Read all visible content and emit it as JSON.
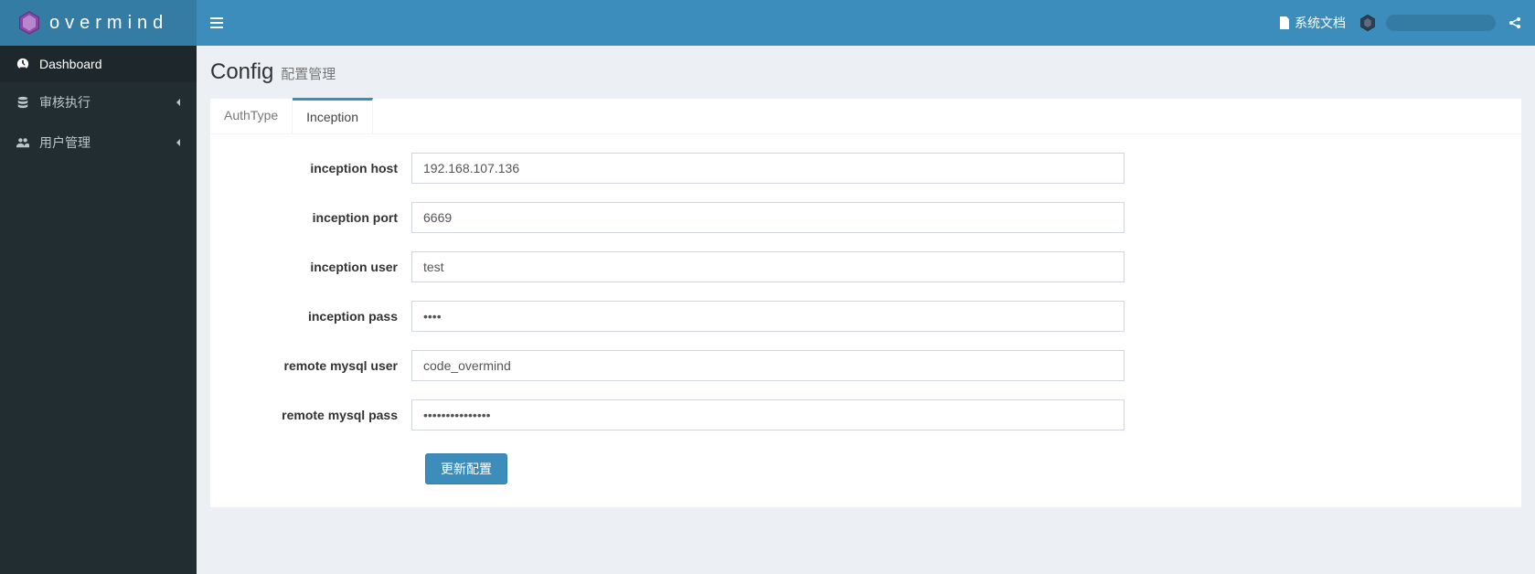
{
  "brand": "overmind",
  "sidebar": {
    "items": [
      {
        "label": "Dashboard",
        "icon": "dashboard-icon",
        "active": true,
        "hasChildren": false
      },
      {
        "label": "审核执行",
        "icon": "database-icon",
        "active": false,
        "hasChildren": true
      },
      {
        "label": "用户管理",
        "icon": "users-icon",
        "active": false,
        "hasChildren": true
      }
    ]
  },
  "topbar": {
    "docs_label": "系统文档",
    "username": ""
  },
  "page": {
    "title": "Config",
    "subtitle": "配置管理"
  },
  "tabs": [
    {
      "label": "AuthType",
      "active": false
    },
    {
      "label": "Inception",
      "active": true
    }
  ],
  "form": {
    "fields": [
      {
        "label": "inception host",
        "value": "192.168.107.136",
        "type": "text"
      },
      {
        "label": "inception port",
        "value": "6669",
        "type": "text"
      },
      {
        "label": "inception user",
        "value": "test",
        "type": "text"
      },
      {
        "label": "inception pass",
        "value": "••••",
        "type": "password"
      },
      {
        "label": "remote mysql user",
        "value": "code_overmind",
        "type": "text"
      },
      {
        "label": "remote mysql pass",
        "value": "•••••••••••••••",
        "type": "password"
      }
    ],
    "submit_label": "更新配置"
  }
}
